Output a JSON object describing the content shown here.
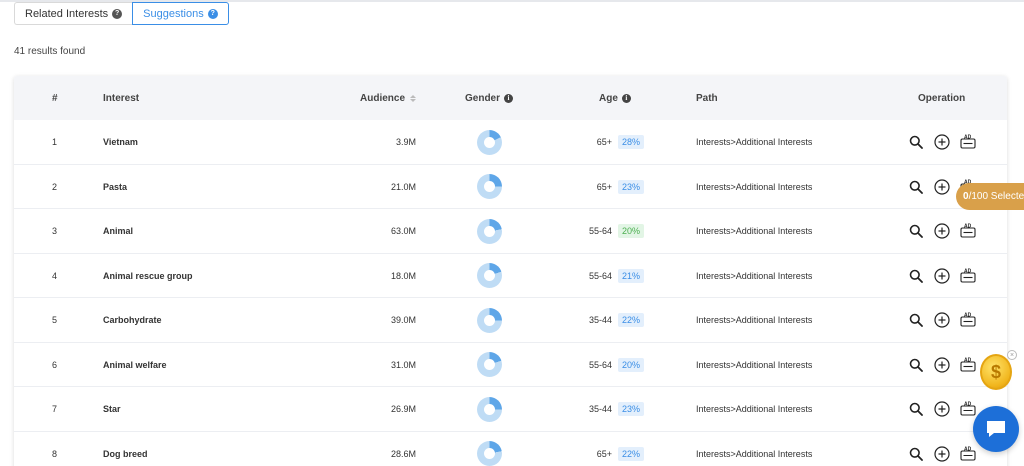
{
  "tabs": [
    {
      "label": "Related Interests",
      "active": false
    },
    {
      "label": "Suggestions",
      "active": true
    }
  ],
  "results_text": "41 results found",
  "table": {
    "headers": {
      "num": "#",
      "interest": "Interest",
      "audience": "Audience",
      "gender": "Gender",
      "age": "Age",
      "path": "Path",
      "operation": "Operation"
    },
    "rows": [
      {
        "num": "1",
        "interest": "Vietnam",
        "audience": "3.9M",
        "age": "65+",
        "age_pct": "28%",
        "pct_color": "blue",
        "path": "Interests>Additional Interests",
        "female_share": 0.18
      },
      {
        "num": "2",
        "interest": "Pasta",
        "audience": "21.0M",
        "age": "65+",
        "age_pct": "23%",
        "pct_color": "blue",
        "path": "Interests>Additional Interests",
        "female_share": 0.25
      },
      {
        "num": "3",
        "interest": "Animal",
        "audience": "63.0M",
        "age": "55-64",
        "age_pct": "20%",
        "pct_color": "green",
        "path": "Interests>Additional Interests",
        "female_share": 0.22
      },
      {
        "num": "4",
        "interest": "Animal rescue group",
        "audience": "18.0M",
        "age": "55-64",
        "age_pct": "21%",
        "pct_color": "blue",
        "path": "Interests>Additional Interests",
        "female_share": 0.2
      },
      {
        "num": "5",
        "interest": "Carbohydrate",
        "audience": "39.0M",
        "age": "35-44",
        "age_pct": "22%",
        "pct_color": "blue",
        "path": "Interests>Additional Interests",
        "female_share": 0.25
      },
      {
        "num": "6",
        "interest": "Animal welfare",
        "audience": "31.0M",
        "age": "55-64",
        "age_pct": "20%",
        "pct_color": "blue",
        "path": "Interests>Additional Interests",
        "female_share": 0.2
      },
      {
        "num": "7",
        "interest": "Star",
        "audience": "26.9M",
        "age": "35-44",
        "age_pct": "23%",
        "pct_color": "blue",
        "path": "Interests>Additional Interests",
        "female_share": 0.25
      },
      {
        "num": "8",
        "interest": "Dog breed",
        "audience": "28.6M",
        "age": "65+",
        "age_pct": "22%",
        "pct_color": "blue",
        "path": "Interests>Additional Interests",
        "female_share": 0.22
      }
    ]
  },
  "selected_badge": {
    "count": "0",
    "rest": "/100 Selecte"
  },
  "colors": {
    "accent": "#3a8ee6",
    "donut_dark": "#5ea6e8",
    "donut_light": "#bfdcf5",
    "badge": "#d9a04a",
    "chat": "#1d6fd8"
  },
  "icons": {
    "search": "search-icon",
    "add": "plus-circle-icon",
    "ad": "ad-icon",
    "coin": "dollar-coin-icon",
    "chat": "chat-icon"
  }
}
